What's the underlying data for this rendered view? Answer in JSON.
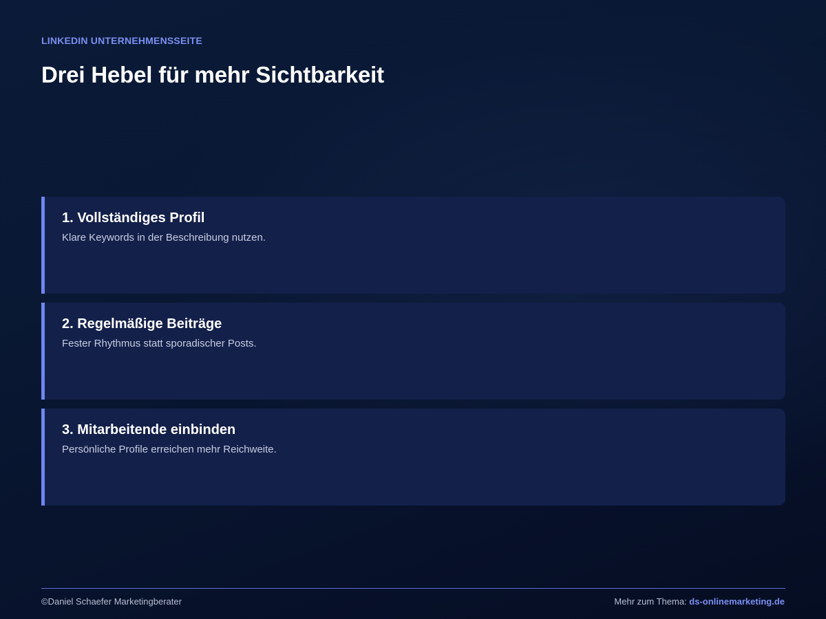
{
  "header": {
    "kicker": "LINKEDIN UNTERNEHMENSSEITE",
    "title": "Drei Hebel für mehr Sichtbarkeit"
  },
  "cards": [
    {
      "title": "1. Vollständiges Profil",
      "text": "Klare Keywords in der Beschreibung nutzen."
    },
    {
      "title": "2. Regelmäßige Beiträge",
      "text": "Fester Rhythmus statt sporadischer Posts."
    },
    {
      "title": "3. Mitarbeitende einbinden",
      "text": "Persönliche Profile erreichen mehr Reichweite."
    }
  ],
  "footer": {
    "copyright": "©Daniel Schaefer Marketingberater",
    "more_label": "Mehr zum Thema:",
    "link_text": "ds-onlinemarketing.de"
  },
  "colors": {
    "accent": "#6f86f0",
    "card_background": "#13204a",
    "page_background": "#091833"
  }
}
